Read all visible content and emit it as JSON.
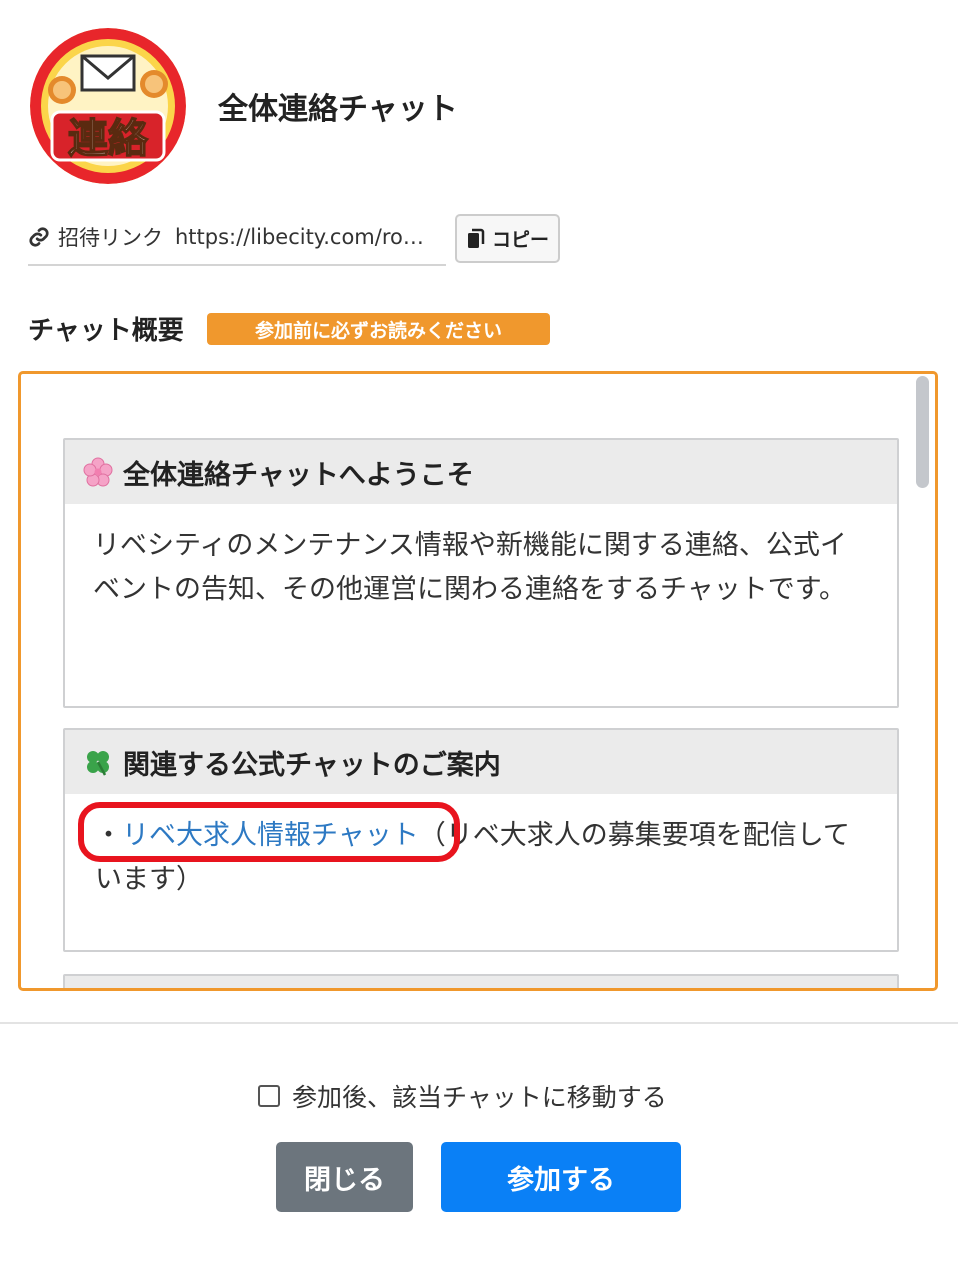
{
  "chat": {
    "title": "全体連絡チャット",
    "avatar_text": "連絡"
  },
  "invite": {
    "label": "招待リンク",
    "url": "https://libecity.com/ro…",
    "copy_label": "コピー",
    "link_icon": "link-icon",
    "copy_icon": "copy-icon"
  },
  "overview": {
    "heading": "チャット概要",
    "badge": "参加前に必ずお読みください",
    "sections": [
      {
        "emoji": "cherry-blossom-icon",
        "title": "全体連絡チャットへようこそ",
        "body": "リベシティのメンテナンス情報や新機能に関する連絡、公式イベントの告知、その他運営に関わる連絡をするチャットです。"
      },
      {
        "emoji": "four-leaf-clover-icon",
        "title": "関連する公式チャットのご案内",
        "bullet": "・",
        "link_text": "リベ大求人情報チャット",
        "body_after_link": "（リベ大求人の募集要項を配信しています）"
      }
    ]
  },
  "footer": {
    "move_checkbox_label": "参加後、該当チャットに移動する",
    "move_checkbox_checked": false,
    "close_label": "閉じる",
    "join_label": "参加する"
  },
  "colors": {
    "accent_orange": "#f0982d",
    "primary_blue": "#0a80f6",
    "secondary_gray": "#6c757d",
    "link_blue": "#2d79c3",
    "highlight_red": "#e8141e"
  }
}
